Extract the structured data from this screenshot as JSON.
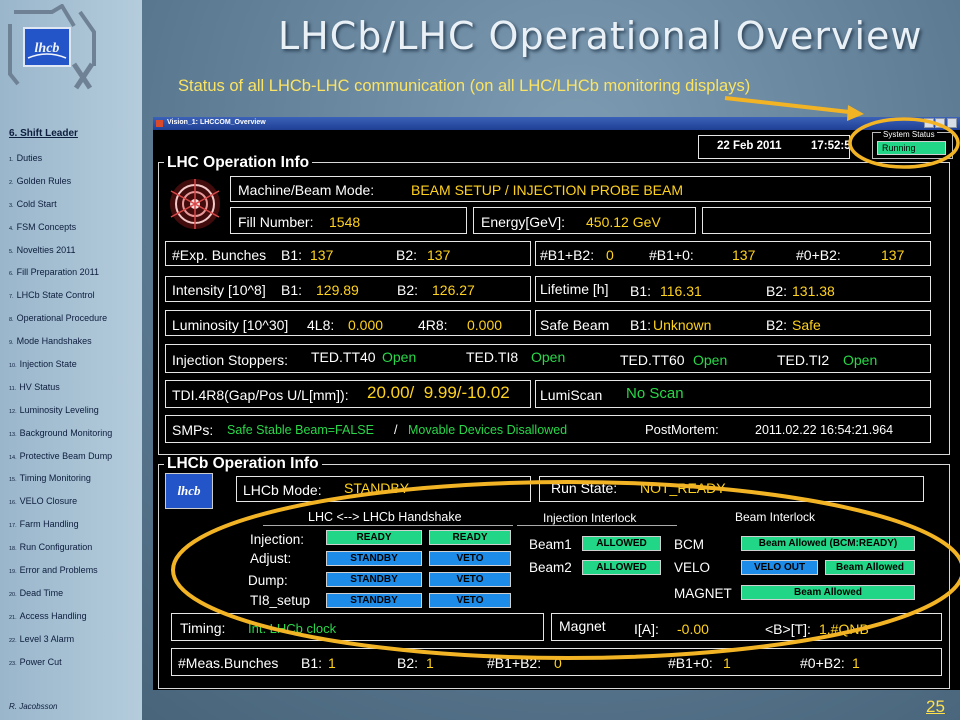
{
  "slide": {
    "title": "LHCb/LHC Operational Overview",
    "subtitle": "Status of all LHCb-LHC communication (on all LHC/LHCb monitoring displays)",
    "page_number": "25",
    "author": "R. Jacobsson"
  },
  "sidebar": {
    "heading": "6. Shift Leader",
    "items": [
      {
        "num": "1.",
        "label": "Duties"
      },
      {
        "num": "2.",
        "label": "Golden Rules"
      },
      {
        "num": "3.",
        "label": "Cold Start"
      },
      {
        "num": "4.",
        "label": "FSM Concepts"
      },
      {
        "num": "5.",
        "label": "Novelties 2011"
      },
      {
        "num": "6.",
        "label": "Fill Preparation 2011"
      },
      {
        "num": "7.",
        "label": "LHCb State Control"
      },
      {
        "num": "8.",
        "label": "Operational Procedure"
      },
      {
        "num": "9.",
        "label": "Mode Handshakes"
      },
      {
        "num": "10.",
        "label": "Injection State"
      },
      {
        "num": "11.",
        "label": "HV Status"
      },
      {
        "num": "12.",
        "label": "Luminosity Leveling"
      },
      {
        "num": "13.",
        "label": "Background Monitoring"
      },
      {
        "num": "14.",
        "label": "Protective Beam Dump"
      },
      {
        "num": "15.",
        "label": "Timing Monitoring"
      },
      {
        "num": "16.",
        "label": "VELO Closure"
      },
      {
        "num": "17.",
        "label": "Farm Handling"
      },
      {
        "num": "18.",
        "label": "Run Configuration"
      },
      {
        "num": "19.",
        "label": "Error and Problems"
      },
      {
        "num": "20.",
        "label": "Dead Time"
      },
      {
        "num": "21.",
        "label": "Access Handling"
      },
      {
        "num": "22.",
        "label": "Level 3 Alarm"
      },
      {
        "num": "23.",
        "label": "Power Cut"
      }
    ]
  },
  "screen": {
    "window_title": "Vision_1: LHCCOM_Overview",
    "date": "22 Feb 2011",
    "time": "17:52:5",
    "system_status": {
      "label": "System Status",
      "value": "Running"
    },
    "lhc": {
      "title": "LHC Operation Info",
      "machine_mode_label": "Machine/Beam Mode:",
      "machine_mode": "BEAM SETUP / INJECTION PROBE BEAM",
      "fill_label": "Fill Number:",
      "fill": "1548",
      "energy_label": "Energy[GeV]:",
      "energy": "450.12 GeV",
      "exp_bunches_label": "#Exp. Bunches",
      "b1_label": "B1:",
      "b2_label": "B2:",
      "exp_b1": "137",
      "exp_b2": "137",
      "b1b2_label": "#B1+B2:",
      "b1b2": "0",
      "b1_0_label": "#B1+0:",
      "b1_0": "137",
      "zero_b2_label": "#0+B2:",
      "zero_b2": "137",
      "intensity_label": "Intensity [10^8]",
      "int_b1": "129.89",
      "int_b2": "126.27",
      "lifetime_label": "Lifetime [h]",
      "life_b1": "116.31",
      "life_b2": "131.38",
      "lumi_label": "Luminosity [10^30]",
      "lumi_4l8_label": "4L8:",
      "lumi_4l8": "0.000",
      "lumi_4r8_label": "4R8:",
      "lumi_4r8": "0.000",
      "safe_beam_label": "Safe Beam",
      "safe_b1": "Unknown",
      "safe_b2": "Safe",
      "stoppers_label": "Injection Stoppers:",
      "tt40_label": "TED.TT40",
      "tt40": "Open",
      "ti8_label": "TED.TI8",
      "ti8": "Open",
      "tt60_label": "TED.TT60",
      "tt60": "Open",
      "ti2_label": "TED.TI2",
      "ti2": "Open",
      "tdi_label": "TDI.4R8(Gap/Pos U/L[mm]):",
      "tdi": "20.00/  9.99/-10.02",
      "lumiscan_label": "LumiScan",
      "lumiscan": "No Scan",
      "smps_label": "SMPs:",
      "smps_stable": "Safe Stable Beam=FALSE",
      "smps_sep": "/",
      "smps_movable": "Movable Devices Disallowed",
      "postmortem_label": "PostMortem:",
      "postmortem": "2011.02.22 16:54:21.964"
    },
    "lhcb": {
      "title": "LHCb Operation Info",
      "mode_label": "LHCb Mode:",
      "mode": "STANDBY",
      "run_state_label": "Run State:",
      "run_state": "NOT_READY",
      "handshake_title": "LHC <--> LHCb Handshake",
      "rows": [
        {
          "label": "Injection:",
          "a": "READY",
          "b": "READY"
        },
        {
          "label": "Adjust:",
          "a": "STANDBY",
          "b": "VETO"
        },
        {
          "label": "Dump:",
          "a": "STANDBY",
          "b": "VETO"
        },
        {
          "label": "TI8_setup",
          "a": "STANDBY",
          "b": "VETO"
        }
      ],
      "injection_interlock_title": "Injection Interlock",
      "beam1_label": "Beam1",
      "beam1": "ALLOWED",
      "beam2_label": "Beam2",
      "beam2": "ALLOWED",
      "beam_interlock_title": "Beam Interlock",
      "bcm_label": "BCM",
      "bcm": "Beam Allowed (BCM:READY)",
      "velo_label": "VELO",
      "velo_out": "VELO OUT",
      "velo_allowed": "Beam Allowed",
      "magnet_label": "MAGNET",
      "magnet_allowed": "Beam Allowed",
      "timing_label": "Timing:",
      "timing": "Int. LHCb clock",
      "magnet_box_label": "Magnet",
      "current_label": "I[A]:",
      "current": "-0.00",
      "field_label": "<B>[T]:",
      "field": "1.#QNB",
      "meas_label": "#Meas.Bunches",
      "meas_b1": "1",
      "meas_b2": "1",
      "meas_b1b2_label": "#B1+B2:",
      "meas_b1b2": "0",
      "meas_b1_0_label": "#B1+0:",
      "meas_b1_0": "1",
      "meas_0b2_label": "#0+B2:",
      "meas_0b2": "1"
    }
  },
  "colors": {
    "value_yellow": "#ffd21e",
    "value_green": "#28d848",
    "button_green": "#21d686",
    "button_blue": "#1c8ce8",
    "highlight_ellipse": "#f2b425",
    "title_text": "#e9f0f6",
    "subtitle_text": "#fbe463"
  }
}
